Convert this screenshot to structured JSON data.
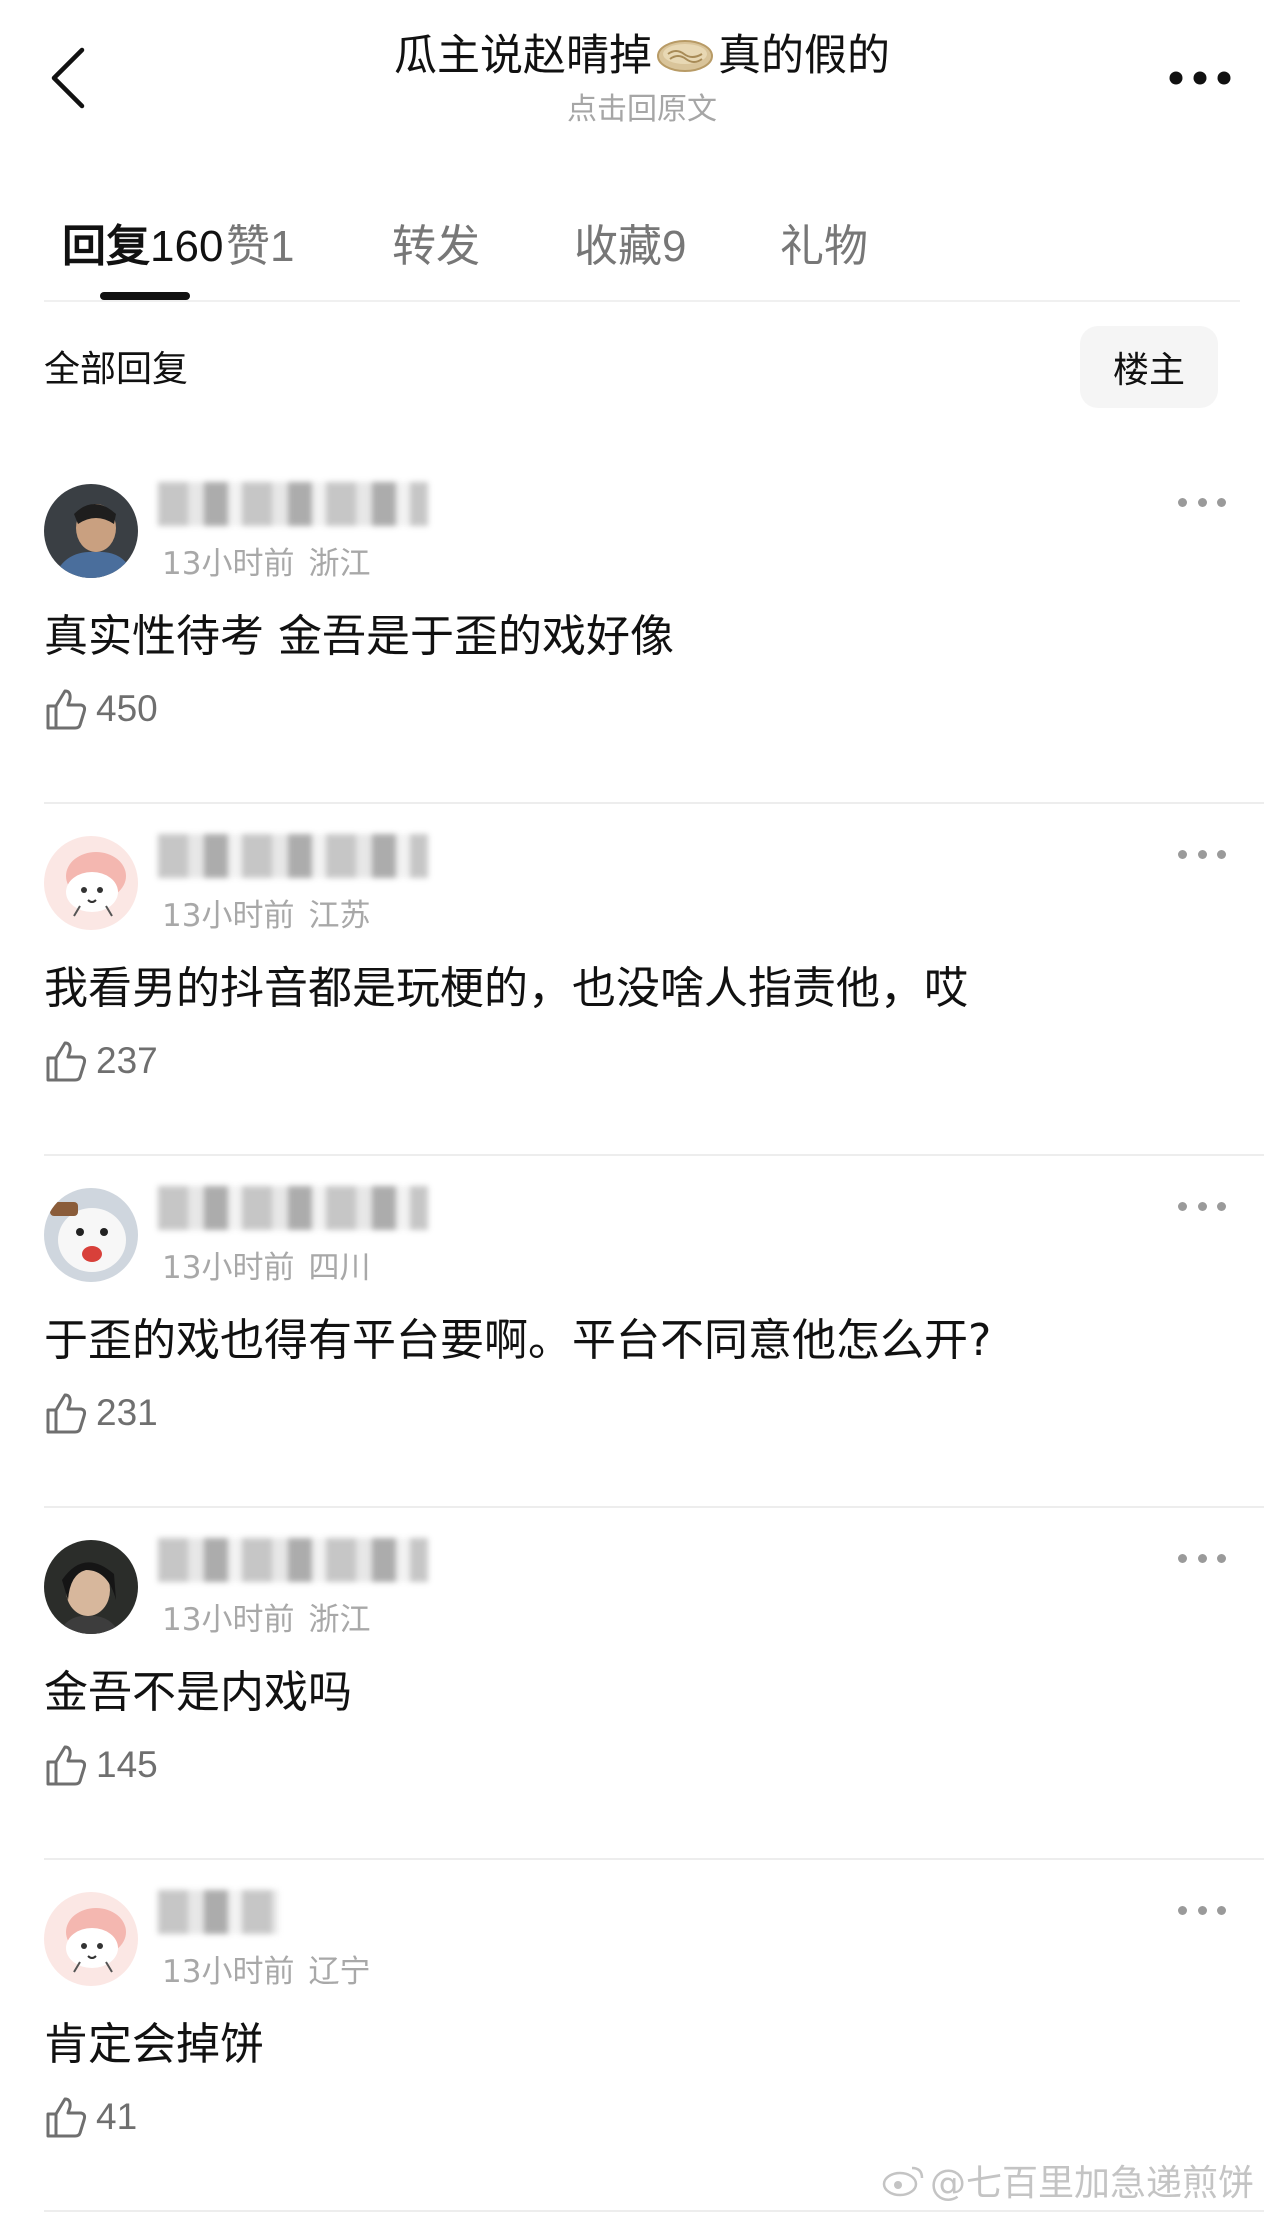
{
  "header": {
    "title_before": "瓜主说赵晴掉",
    "title_icon": "flatbread-emoji",
    "title_after": "真的假的",
    "subtitle": "点击回原文"
  },
  "tabs": [
    {
      "label": "回复",
      "count": "160"
    },
    {
      "label": "赞",
      "count": "1"
    },
    {
      "label": "转发",
      "count": ""
    },
    {
      "label": "收藏",
      "count": "9"
    },
    {
      "label": "礼物",
      "count": ""
    }
  ],
  "filter": {
    "label": "全部回复",
    "owner_button": "楼主"
  },
  "comments": [
    {
      "time": "13小时前",
      "location": "浙江",
      "text": "真实性待考 金吾是于歪的戏好像",
      "likes": "450",
      "avatar": "photo-man"
    },
    {
      "time": "13小时前",
      "location": "江苏",
      "text": "我看男的抖音都是玩梗的，也没啥人指责他，哎",
      "likes": "237",
      "avatar": "pink-cartoon"
    },
    {
      "time": "13小时前",
      "location": "四川",
      "text": "于歪的戏也得有平台要啊。平台不同意他怎么开?",
      "likes": "231",
      "avatar": "white-dog"
    },
    {
      "time": "13小时前",
      "location": "浙江",
      "text": "金吾不是内戏吗",
      "likes": "145",
      "avatar": "photo-woman"
    },
    {
      "time": "13小时前",
      "location": "辽宁",
      "text": "肯定会掉饼",
      "likes": "41",
      "avatar": "pink-cartoon"
    }
  ],
  "watermark": "@七百里加急递煎饼",
  "colors": {
    "text": "#111111",
    "muted": "#a8a8a8",
    "divider": "#ededed"
  }
}
